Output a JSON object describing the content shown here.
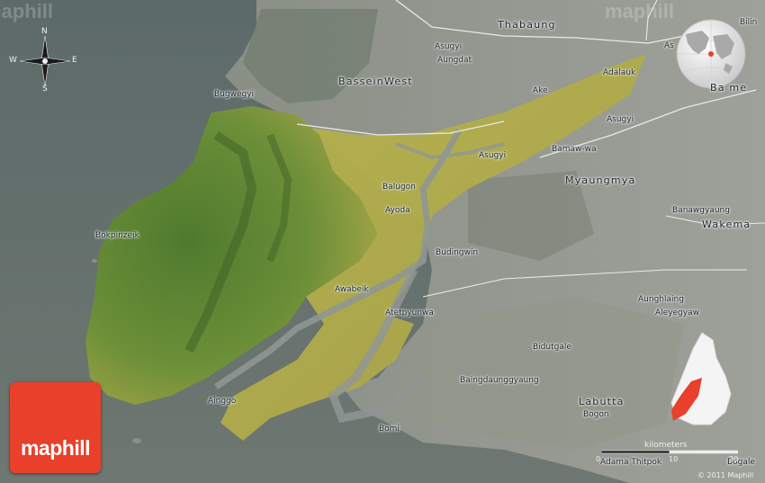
{
  "map": {
    "watermark": "maphill",
    "logo_text": "maphill",
    "copyright": "© 2011 Maphill",
    "compass": {
      "n": "N",
      "s": "S",
      "e": "E",
      "w": "W"
    },
    "scale": {
      "title": "kilometers",
      "zero": "0",
      "ten": "10",
      "twenty": "20"
    },
    "labels": {
      "thabaung": "Thabaung",
      "bilin": "Bilin",
      "asugyi_n": "Asugyi",
      "aungdat": "Aungdat",
      "as": "As",
      "adalauk": "Adalauk",
      "bassein_west": "BasseinWest",
      "bugwegyi": "Bugwegyi",
      "ake": "Ake",
      "bame": "Ba me",
      "asugyi_e": "Asugyi",
      "bamawwa": "Bamaw-wa",
      "asugyi_c": "Asugyi",
      "myaungmya": "Myaungmya",
      "balugon": "Balugon",
      "ayoda": "Ayoda",
      "banawgyaung": "Banawgyaung",
      "wakema": "Wakema",
      "bokpinzeik": "Bokpinzeik",
      "budingwin": "Budingwin",
      "awabeik": "Awabeik",
      "aunglaing": "Aunghlaing",
      "aleyegyaw": "Aleyegyaw",
      "atetpyunwa": "Atetpyunwa",
      "bidutgale": "Bidutgale",
      "baingdaunggyaung": "Baingdaunggyaung",
      "labutta": "Labutta",
      "bogon": "Bogon",
      "ainggo": "Ainggo",
      "bomi": "Bomi",
      "adama_thitpok": "Adama Thitpok",
      "bogale": "Bogale"
    },
    "colors": {
      "sea": "#5d6a67",
      "land_gray": "#8d918a",
      "region_yellow": "#b9b54e",
      "region_green": "#6f8f3d",
      "logo_red": "#e8402b"
    }
  }
}
